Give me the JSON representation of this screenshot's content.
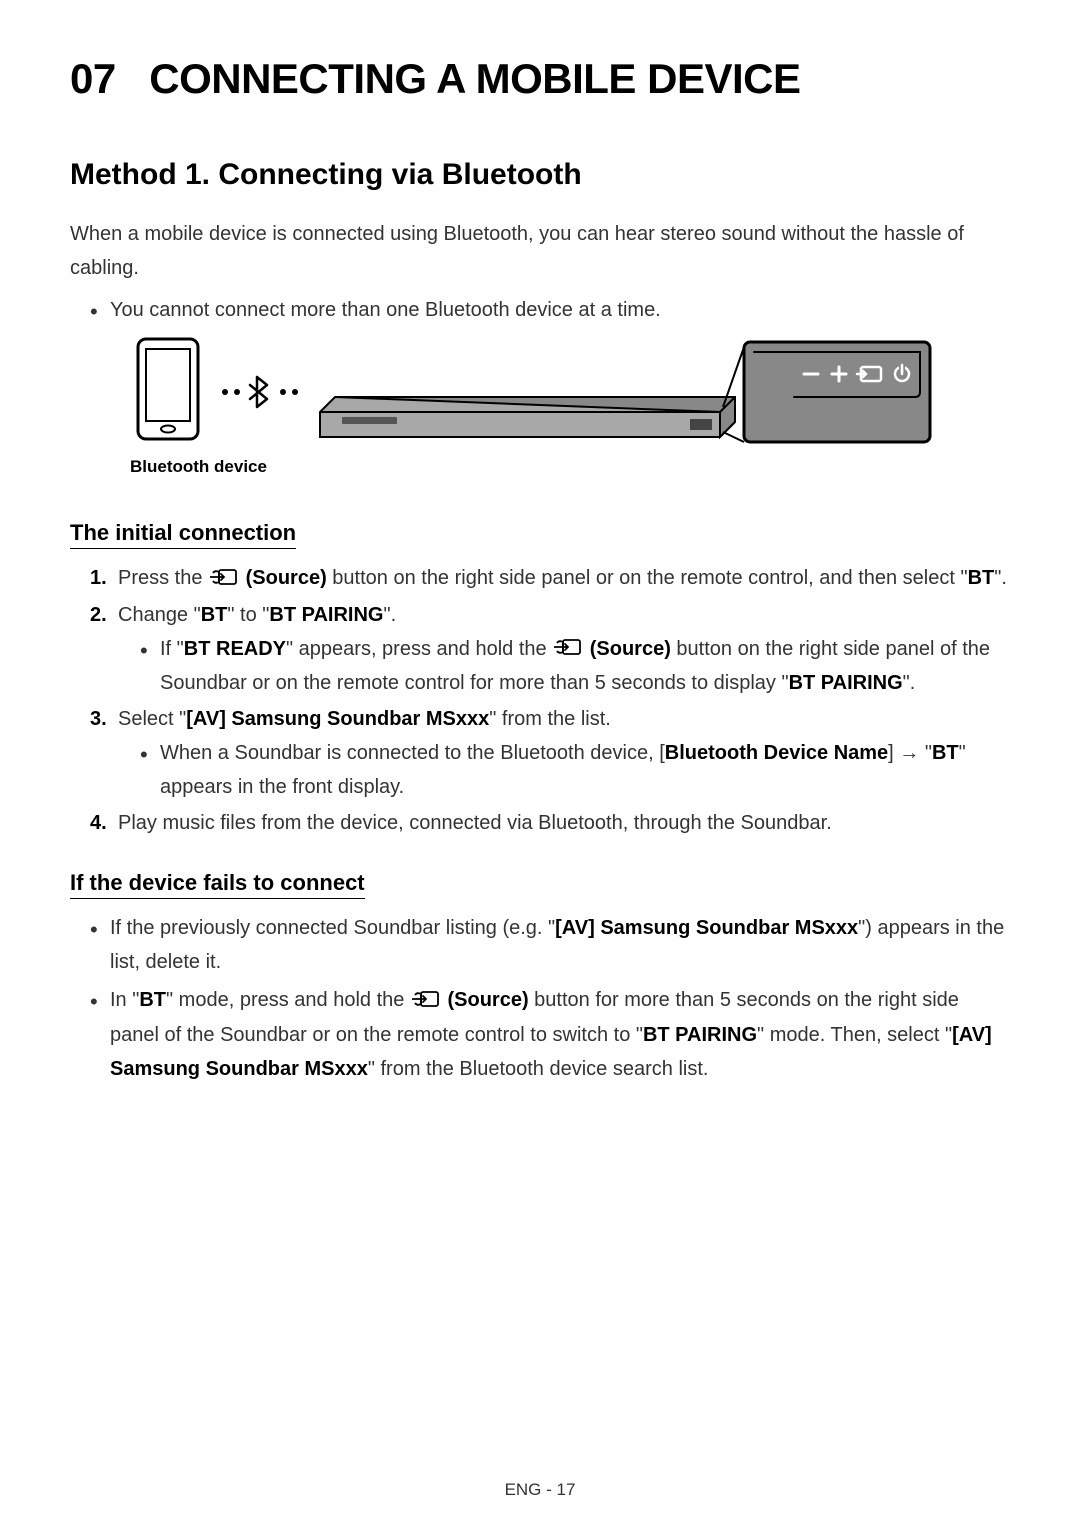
{
  "chapter": {
    "number": "07",
    "title": "CONNECTING A MOBILE DEVICE"
  },
  "section1": {
    "heading": "Method 1. Connecting via Bluetooth",
    "intro": "When a mobile device is connected using Bluetooth, you can hear stereo sound without the hassle of cabling.",
    "bullet1": "You cannot connect more than one Bluetooth device at a time.",
    "diagram_label": "Bluetooth device"
  },
  "initial": {
    "heading": "The initial connection",
    "step1_pre": "Press the ",
    "step1_source": " (Source)",
    "step1_post": " button on the right side panel or on the remote control, and then select \"",
    "step1_bt": "BT",
    "step1_end": "\".",
    "step2_pre": "Change \"",
    "step2_bt": "BT",
    "step2_mid": "\" to \"",
    "step2_btpairing": "BT PAIRING",
    "step2_end": "\".",
    "step2_sub_pre": "If \"",
    "step2_sub_btready": "BT READY",
    "step2_sub_mid1": "\" appears, press and hold the ",
    "step2_sub_source": " (Source)",
    "step2_sub_mid2": " button on the right side panel of the Soundbar or on the remote control for more than 5 seconds to display \"",
    "step2_sub_btpairing": "BT PAIRING",
    "step2_sub_end": "\".",
    "step3_pre": "Select \"",
    "step3_device": "[AV] Samsung Soundbar MSxxx",
    "step3_post": "\" from the list.",
    "step3_sub_pre": "When a Soundbar is connected to the Bluetooth device, [",
    "step3_sub_bdn": "Bluetooth Device Name",
    "step3_sub_mid": "] → \"",
    "step3_sub_bt": "BT",
    "step3_sub_post": "\" appears in the front display.",
    "step4": "Play music files from the device, connected via Bluetooth, through the Soundbar."
  },
  "fails": {
    "heading": "If the device fails to connect",
    "b1_pre": "If the previously connected Soundbar listing (e.g. \"",
    "b1_device": "[AV] Samsung Soundbar MSxxx",
    "b1_post": "\") appears in the list, delete it.",
    "b2_pre": "In \"",
    "b2_bt": "BT",
    "b2_mid1": "\" mode, press and hold the ",
    "b2_source": " (Source)",
    "b2_mid2": " button for more than 5 seconds on the right side panel of the Soundbar or on the remote control to switch to \"",
    "b2_btpairing": "BT PAIRING",
    "b2_mid3": "\" mode. Then, select \"",
    "b2_device": "[AV] Samsung Soundbar MSxxx",
    "b2_end": "\" from the Bluetooth device search list."
  },
  "page_number": "ENG - 17"
}
